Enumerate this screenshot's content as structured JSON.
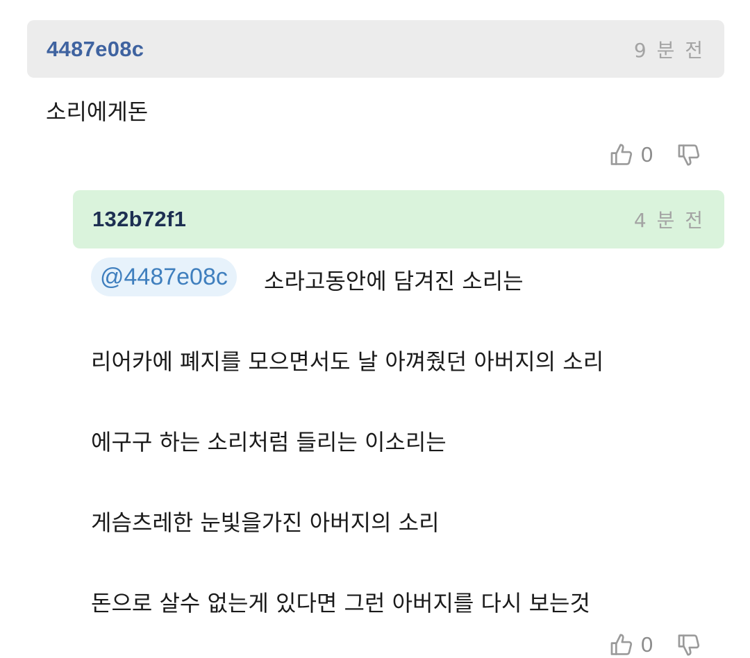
{
  "comments": [
    {
      "author": "4487e08c",
      "time": "9 분 전",
      "text": "소리에게돈",
      "likes": "0"
    }
  ],
  "reply": {
    "author": "132b72f1",
    "time": "4 분 전",
    "mention": "@4487e08c",
    "lines": [
      "소라고동안에 담겨진 소리는",
      "리어카에 폐지를 모으면서도 날 아껴줬던 아버지의 소리",
      "에구구 하는 소리처럼 들리는 이소리는",
      "게슴츠레한 눈빛을가진 아버지의 소리",
      "돈으로 살수 없는게 있다면 그런 아버지를 다시 보는것"
    ],
    "likes": "0"
  },
  "icons": {
    "like": "thumbs-up-icon",
    "dislike": "thumbs-down-icon"
  },
  "colors": {
    "main_header_bg": "#ececec",
    "reply_header_bg": "#daf3dc",
    "author_main": "#3f63a0",
    "author_reply": "#1d2f52",
    "mention_text": "#3f7fbe",
    "mention_bg": "#e7f2fb"
  }
}
